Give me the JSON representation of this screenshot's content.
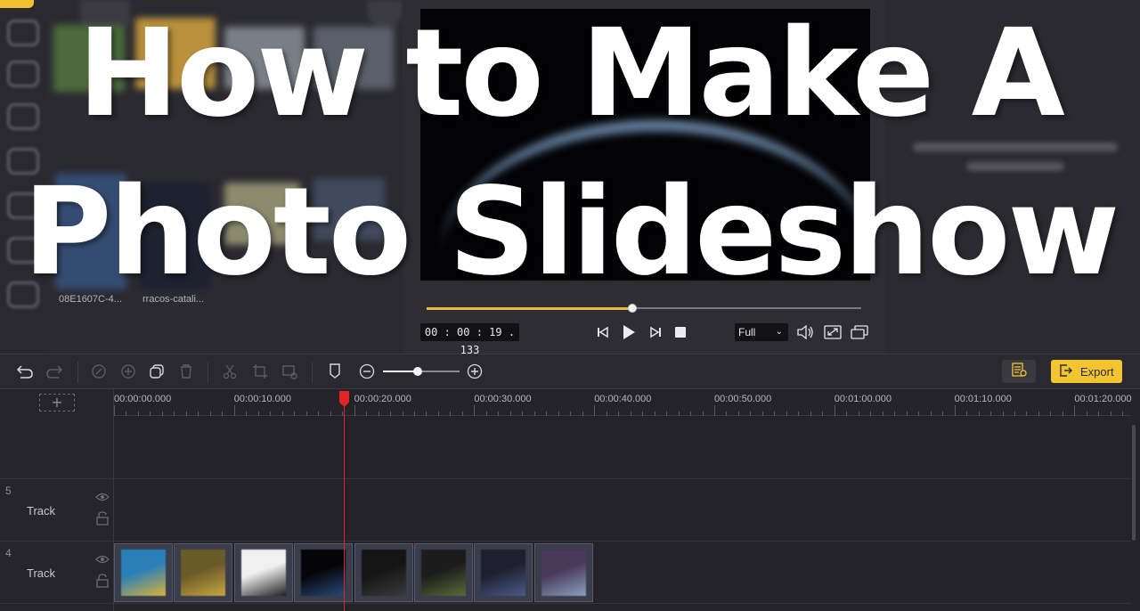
{
  "headline": {
    "line1": "How to Make A",
    "line2": "Photo Slideshow"
  },
  "media": {
    "captions": [
      "08E1607C-4...",
      "rracos-catali..."
    ]
  },
  "preview": {
    "progress": 0.474,
    "timecode": "00 : 00 : 19 . 133",
    "zoom_value": "Full",
    "icons": [
      "step-back-icon",
      "play-icon",
      "step-forward-icon",
      "stop-icon",
      "volume-icon",
      "fullscreen-icon",
      "detach-window-icon"
    ]
  },
  "toolbar": {
    "zoom_level": 0.45,
    "export_label": "Export",
    "icons": [
      "undo-icon",
      "redo-icon",
      "edit-icon",
      "add-icon",
      "copy-icon",
      "delete-icon",
      "cut-icon",
      "crop-icon",
      "more-icon",
      "marker-icon",
      "zoom-out-icon",
      "zoom-in-icon",
      "text-to-speech-icon",
      "export-icon"
    ]
  },
  "timeline": {
    "add_track_label": "+",
    "ruler": [
      "00:00:00.000",
      "00:00:10.000",
      "00:00:20.000",
      "00:00:30.000",
      "00:00:40.000",
      "00:00:50.000",
      "00:01:00.000",
      "00:01:10.000",
      "00:01:20.000"
    ],
    "playhead_seconds": 19.133,
    "tracks": [
      {
        "number": "5",
        "label": "Track"
      },
      {
        "number": "4",
        "label": "Track"
      }
    ],
    "clips": [
      {
        "colors": [
          "#2a7fb8",
          "#d9b23a"
        ]
      },
      {
        "colors": [
          "#6a5a2a",
          "#c9a640"
        ]
      },
      {
        "colors": [
          "#f0f0f0",
          "#202020"
        ]
      },
      {
        "colors": [
          "#050508",
          "#2a4a7a"
        ]
      },
      {
        "colors": [
          "#151515",
          "#3a3a3a"
        ]
      },
      {
        "colors": [
          "#1c1c1c",
          "#5a6a3a"
        ]
      },
      {
        "colors": [
          "#1e2030",
          "#4a5a8a"
        ]
      },
      {
        "colors": [
          "#4a3a5a",
          "#8aa0c0"
        ]
      }
    ]
  }
}
